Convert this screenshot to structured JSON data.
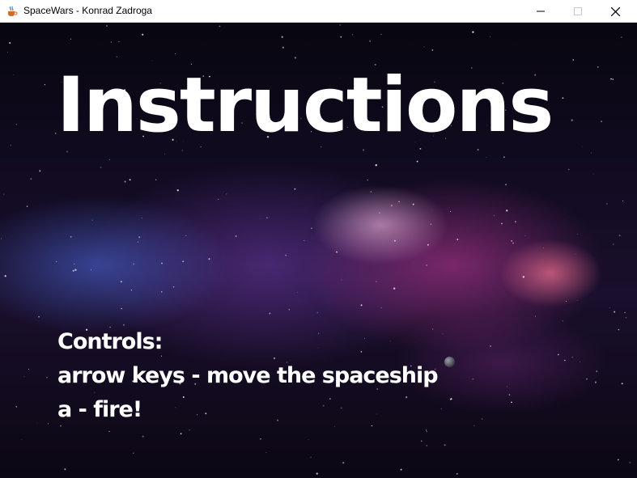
{
  "window": {
    "title": "SpaceWars - Konrad Zadroga",
    "app_icon": "java-coffee-cup-icon",
    "buttons": [
      "minimize-icon",
      "maximize-icon",
      "close-icon"
    ]
  },
  "screen": {
    "heading": "Instructions",
    "controls_label": "Controls:",
    "lines": [
      "arrow keys - move the spaceship",
      "a - fire!"
    ]
  }
}
